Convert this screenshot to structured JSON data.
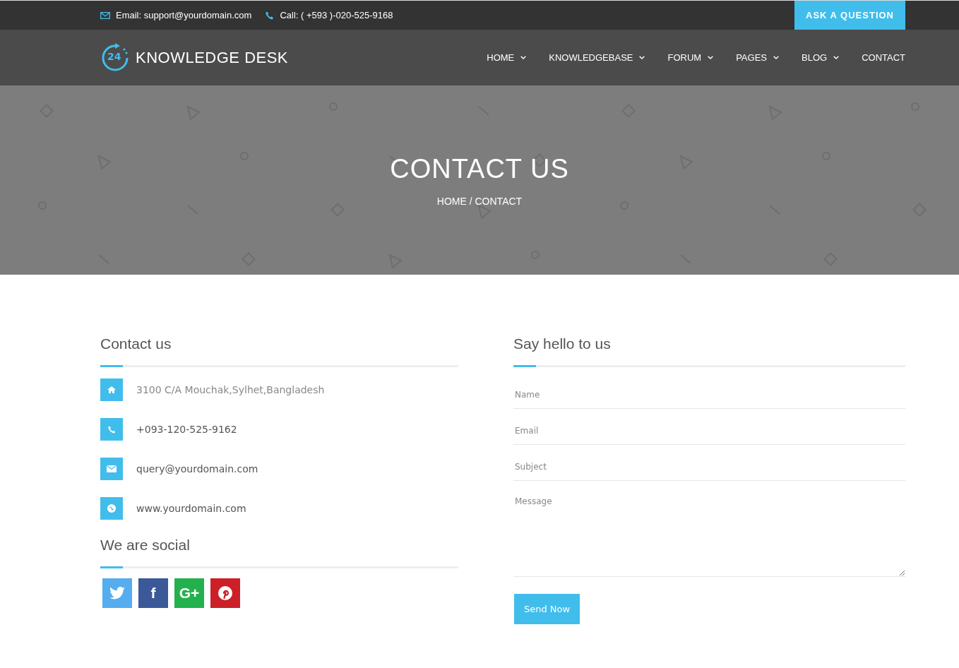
{
  "top_bar": {
    "email": "Email: support@yourdomain.com",
    "phone": "Call: ( +593 )-020-525-9168",
    "ask_button": "ASK A QUESTION"
  },
  "logo": {
    "badge": "24",
    "name": "KNOWLEDGE DESK"
  },
  "nav": [
    {
      "label": "HOME",
      "dropdown": true
    },
    {
      "label": "KNOWLEDGEBASE",
      "dropdown": true
    },
    {
      "label": "FORUM",
      "dropdown": true
    },
    {
      "label": "PAGES",
      "dropdown": true
    },
    {
      "label": "BLOG",
      "dropdown": true
    },
    {
      "label": "CONTACT",
      "dropdown": false
    }
  ],
  "hero": {
    "title": "CONTACT US",
    "breadcrumb": "HOME / CONTACT"
  },
  "contact": {
    "title": "Contact us",
    "items": [
      {
        "kind": "address",
        "text": "3100 C/A Mouchak,Sylhet,Bangladesh"
      },
      {
        "kind": "phone",
        "text": "+093-120-525-9162"
      },
      {
        "kind": "email",
        "text": "query@yourdomain.com"
      },
      {
        "kind": "web",
        "text": "www.yourdomain.com"
      }
    ]
  },
  "social": {
    "title": "We are social",
    "links": [
      {
        "kind": "twitter",
        "color": "#55acee"
      },
      {
        "kind": "facebook",
        "color": "#3b5998",
        "glyph": "f"
      },
      {
        "kind": "google",
        "color": "#23b14d",
        "glyph": "G+"
      },
      {
        "kind": "pinterest",
        "color": "#cb2027"
      }
    ]
  },
  "form": {
    "title": "Say hello to us",
    "fields": [
      {
        "kind": "input",
        "placeholder": "Name"
      },
      {
        "kind": "input",
        "placeholder": "Email"
      },
      {
        "kind": "input",
        "placeholder": "Subject"
      },
      {
        "kind": "textarea",
        "placeholder": "Message"
      }
    ],
    "submit": "Send Now"
  }
}
